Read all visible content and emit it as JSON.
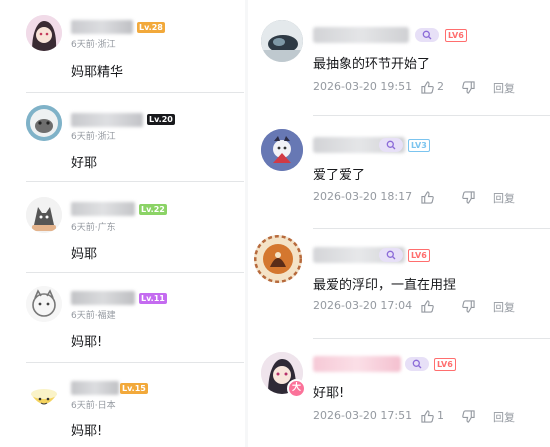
{
  "left_comments": [
    {
      "level": "Lv.28",
      "meta": "6天前·浙江",
      "text": "妈耶精华",
      "level_color": "#f2a93b",
      "avatar_icon": "anime-girl-avatar-icon"
    },
    {
      "level": "Lv.20",
      "meta": "6天前·浙江",
      "text": "好耶",
      "level_color": "#18191c",
      "avatar_icon": "cat-avatar-icon"
    },
    {
      "level": "Lv.22",
      "meta": "6天前·广东",
      "text": "妈耶",
      "level_color": "#8bd366",
      "avatar_icon": "cat-toy-avatar-icon"
    },
    {
      "level": "Lv.11",
      "meta": "6天前·福建",
      "text": "妈耶!",
      "level_color": "#c46bf0",
      "avatar_icon": "sketch-cat-avatar-icon"
    },
    {
      "level": "Lv.15",
      "meta": "6天前·日本",
      "text": "妈耶!",
      "level_color": "#f2a93b",
      "avatar_icon": "smiley-bowl-avatar-icon"
    }
  ],
  "right_comments": [
    {
      "level": "LV6",
      "text": "最抽象的环节开始了",
      "date": "2026-03-20 19:51",
      "likes": "2",
      "reply": "回复",
      "level_color": "#ff6e6e",
      "avatar_icon": "blurred-photo-avatar-icon"
    },
    {
      "level": "LV3",
      "text": "爱了爱了",
      "date": "2026-03-20 18:17",
      "likes": "",
      "reply": "回复",
      "level_color": "#7bc4ef",
      "avatar_icon": "character-avatar-icon"
    },
    {
      "level": "LV6",
      "text": "最爱的浮印，一直在用捏",
      "date": "2026-03-20 17:04",
      "likes": "",
      "reply": "回复",
      "level_color": "#ff6e6e",
      "avatar_icon": "ornate-seal-avatar-icon"
    },
    {
      "level": "LV6",
      "text": "好耶!",
      "date": "2026-03-20 17:51",
      "likes": "1",
      "reply": "回复",
      "level_color": "#ff6e6e",
      "avatar_icon": "anime-girl-avatar-icon",
      "badge": "大"
    }
  ]
}
